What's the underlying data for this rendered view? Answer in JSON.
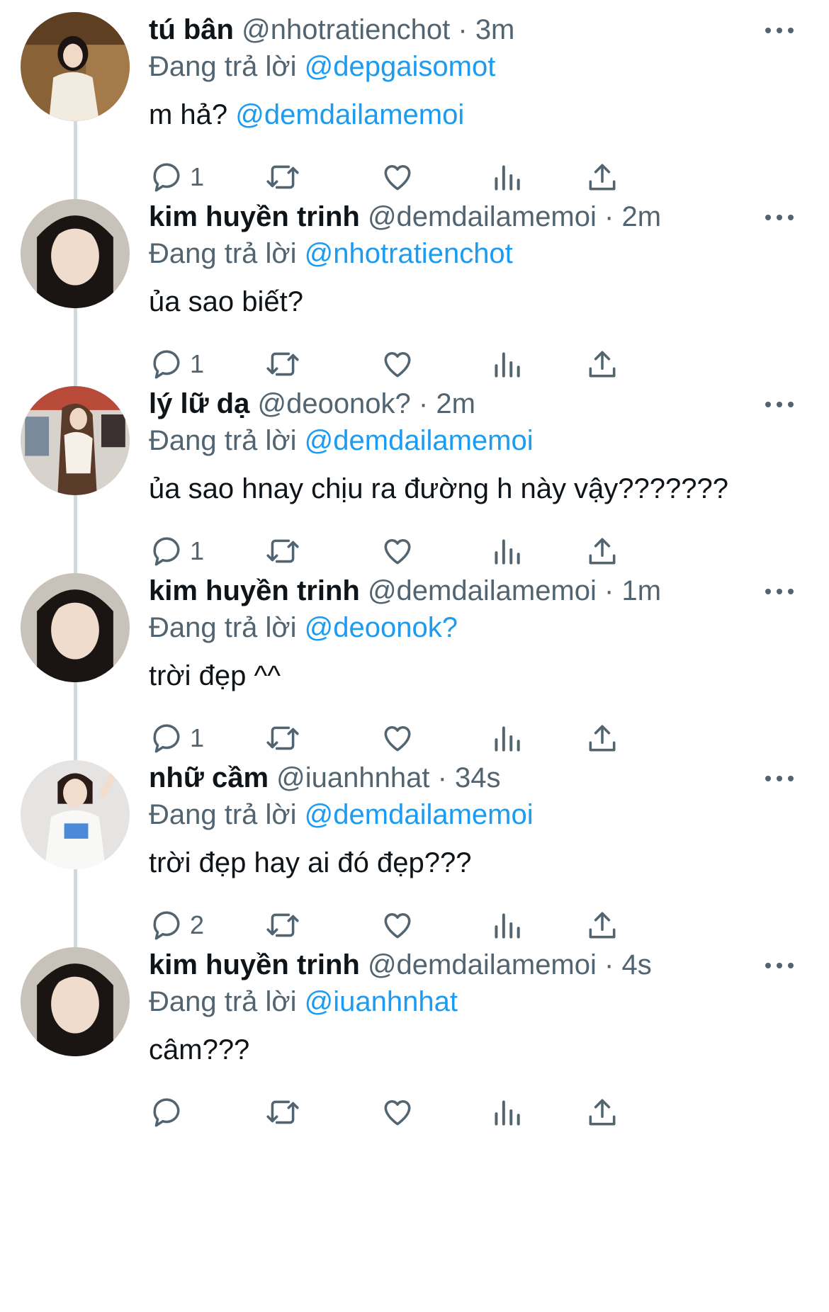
{
  "reply_prefix": "Đang trả lời",
  "colors": {
    "mention": "#1d9bf0",
    "secondary": "#536471",
    "thread_line": "#cfd9de"
  },
  "icons": {
    "reply": "speech-bubble-icon",
    "retweet": "retweet-icon",
    "like": "heart-icon",
    "views": "bar-chart-icon",
    "share": "share-upload-icon",
    "more": "more-dots-icon"
  },
  "tweets": [
    {
      "name": "tú bân",
      "handle": "@nhotratienchot",
      "time": "3m",
      "reply_to": "@depgaisomot",
      "text": "m hả? ",
      "text_mention": "@demdailamemoi",
      "reply_count": "1"
    },
    {
      "name": "kim huyền trinh",
      "handle": "@demdailamemoi",
      "time": "2m",
      "reply_to": "@nhotratienchot",
      "text": "ủa sao biết?",
      "text_mention": "",
      "reply_count": "1"
    },
    {
      "name": "lý lữ dạ",
      "handle": "@deoonok?",
      "time": "2m",
      "reply_to": "@demdailamemoi",
      "text": "ủa sao hnay chịu ra đường h này vậy???????",
      "text_mention": "",
      "reply_count": "1"
    },
    {
      "name": "kim huyền trinh",
      "handle": "@demdailamemoi",
      "time": "1m",
      "reply_to": "@deoonok?",
      "text": "trời đẹp ^^",
      "text_mention": "",
      "reply_count": "1"
    },
    {
      "name": "nhữ cầm",
      "handle": "@iuanhnhat",
      "time": "34s",
      "reply_to": "@demdailamemoi",
      "text": "trời đẹp hay ai đó đẹp???",
      "text_mention": "",
      "reply_count": "2"
    },
    {
      "name": "kim huyền trinh",
      "handle": "@demdailamemoi",
      "time": "4s",
      "reply_to": "@iuanhnhat",
      "text": "câm???",
      "text_mention": "",
      "reply_count": ""
    }
  ]
}
